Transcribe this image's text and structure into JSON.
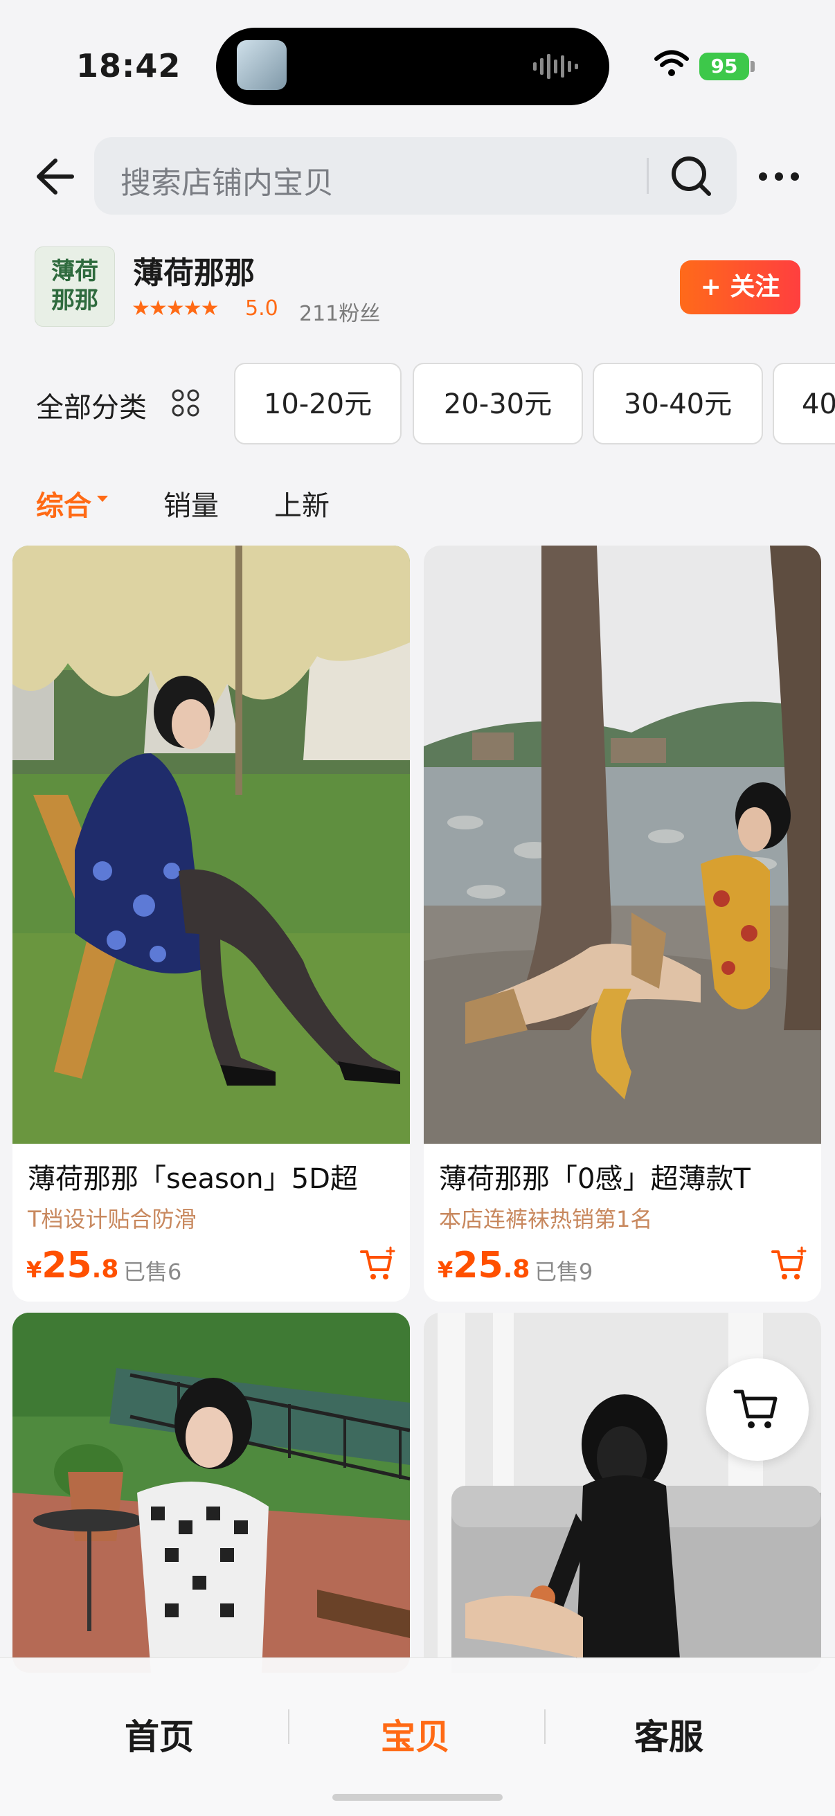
{
  "status_bar": {
    "time": "18:42",
    "battery": "95"
  },
  "search": {
    "placeholder": "搜索店铺内宝贝"
  },
  "store": {
    "logo_text": "薄荷那那",
    "name": "薄荷那那",
    "stars": "★★★★★",
    "rating": "5.0",
    "fans": "211粉丝",
    "follow_label": "+ 关注"
  },
  "filters": {
    "all_label": "全部分类",
    "chips": [
      "10-20元",
      "20-30元",
      "30-40元",
      "40"
    ]
  },
  "sort": {
    "tabs": [
      "综合",
      "销量",
      "上新"
    ]
  },
  "products": [
    {
      "title": "薄荷那那「season」5D超",
      "tag": "T档设计贴合防滑",
      "price_currency": "¥",
      "price_int": "25",
      "price_dec": ".8",
      "sold": "已售6"
    },
    {
      "title": "薄荷那那「0感」超薄款T",
      "tag": "本店连裤袜热销第1名",
      "price_currency": "¥",
      "price_int": "25",
      "price_dec": ".8",
      "sold": "已售9"
    }
  ],
  "bottom_nav": {
    "items": [
      "首页",
      "宝贝",
      "客服"
    ]
  },
  "colors": {
    "accent": "#ff6a15",
    "price": "#ff5000",
    "follow_gradient": [
      "#ff6a1a",
      "#ff3f3f"
    ]
  },
  "icons": [
    "back-arrow-icon",
    "search-icon",
    "more-icon",
    "category-grid-icon",
    "cart-add-icon",
    "cart-icon"
  ]
}
